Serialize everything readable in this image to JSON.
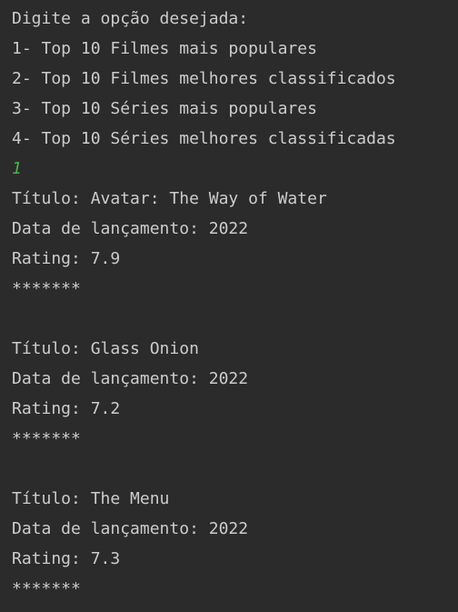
{
  "console": {
    "prompt": "Digite a opção desejada:",
    "menu": [
      "1- Top 10 Filmes mais populares",
      "2- Top 10 Filmes melhores classificados",
      "3- Top 10 Séries mais populares",
      "4- Top 10 Séries melhores classificadas"
    ],
    "user_input": "1",
    "user_input_color": "#4caf50",
    "text_color": "#cccccc",
    "background_color": "#2b2b2b",
    "separator": "*******",
    "results": [
      {
        "title": "Título: Avatar: The Way of Water",
        "release": "Data de lançamento: 2022",
        "rating": "Rating: 7.9"
      },
      {
        "title": "Título: Glass Onion",
        "release": "Data de lançamento: 2022",
        "rating": "Rating: 7.2"
      },
      {
        "title": "Título: The Menu",
        "release": "Data de lançamento: 2022",
        "rating": "Rating: 7.3"
      }
    ]
  }
}
